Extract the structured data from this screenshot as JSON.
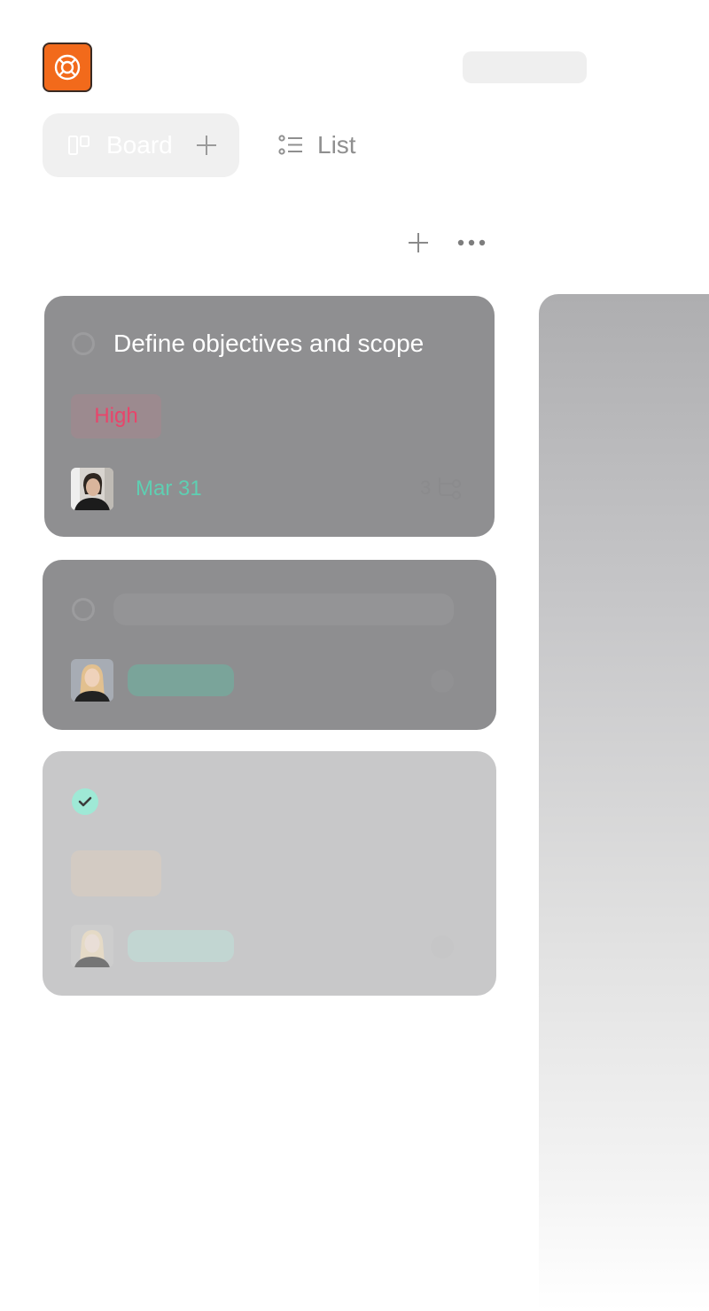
{
  "header": {
    "logo_icon": "lifebuoy-icon",
    "accent": "#f26a1b"
  },
  "view_tabs": {
    "board": {
      "label": "Board",
      "icon": "board-icon",
      "add_icon": "plus-icon"
    },
    "list": {
      "label": "List",
      "icon": "list-icon"
    }
  },
  "column": {
    "add_icon": "plus-icon",
    "more_icon": "more-horizontal-icon"
  },
  "cards": [
    {
      "title": "Define objectives and scope",
      "priority": "High",
      "priority_color": "#e8456b",
      "date": "Mar 31",
      "subtasks": "3",
      "completed": false
    },
    {
      "completed": false
    },
    {
      "completed": true,
      "check_color": "#9fe9d6"
    }
  ]
}
